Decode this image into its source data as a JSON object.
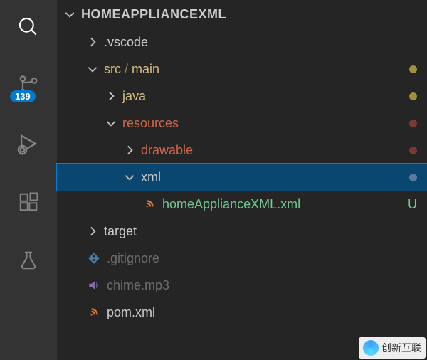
{
  "activity_bar": {
    "items": [
      {
        "name": "search-icon"
      },
      {
        "name": "source-control-icon",
        "badge": "139"
      },
      {
        "name": "run-debug-icon"
      },
      {
        "name": "extensions-icon"
      },
      {
        "name": "test-beaker-icon"
      }
    ]
  },
  "explorer": {
    "section_title": "HOMEAPPLIANCEXML",
    "rows": [
      {
        "indent": 1,
        "twisty": ">",
        "type": "folder",
        "label": ".vscode",
        "label_color": "#cccccc"
      },
      {
        "indent": 1,
        "twisty": "v",
        "type": "folder",
        "label_parts": [
          "src",
          "/",
          "main"
        ],
        "label_color": "#d7ba7d",
        "status_dot": "#a38e3a"
      },
      {
        "indent": 2,
        "twisty": ">",
        "type": "folder",
        "label": "java",
        "label_color": "#d7ba7d",
        "status_dot": "#a38e3a"
      },
      {
        "indent": 2,
        "twisty": "v",
        "type": "folder",
        "label": "resources",
        "label_color": "#d1664a",
        "status_dot": "#7a3a2f"
      },
      {
        "indent": 3,
        "twisty": ">",
        "type": "folder",
        "label": "drawable",
        "label_color": "#d1664a",
        "status_dot": "#7a3a2f"
      },
      {
        "indent": 3,
        "twisty": "v",
        "type": "folder",
        "label": "xml",
        "label_color": "#cccccc",
        "selected": true,
        "status_dot": "#5a7a99"
      },
      {
        "indent": 4,
        "type": "file-xml",
        "label": "homeApplianceXML.xml",
        "label_color": "#73c991",
        "status_letter": "U",
        "status_letter_color": "#73c991"
      },
      {
        "indent": 1,
        "twisty": ">",
        "type": "folder",
        "label": "target",
        "label_color": "#cccccc"
      },
      {
        "indent": 1,
        "type": "file-git",
        "label": ".gitignore",
        "label_color": "#6e6e6e"
      },
      {
        "indent": 1,
        "type": "file-audio",
        "label": "chime.mp3",
        "label_color": "#6e6e6e"
      },
      {
        "indent": 1,
        "type": "file-xml",
        "label": "pom.xml",
        "label_color": "#cccccc"
      }
    ]
  },
  "watermark": {
    "text": "创新互联"
  },
  "colors": {
    "badge_bg": "#007acc",
    "selection_bg": "#094771"
  }
}
